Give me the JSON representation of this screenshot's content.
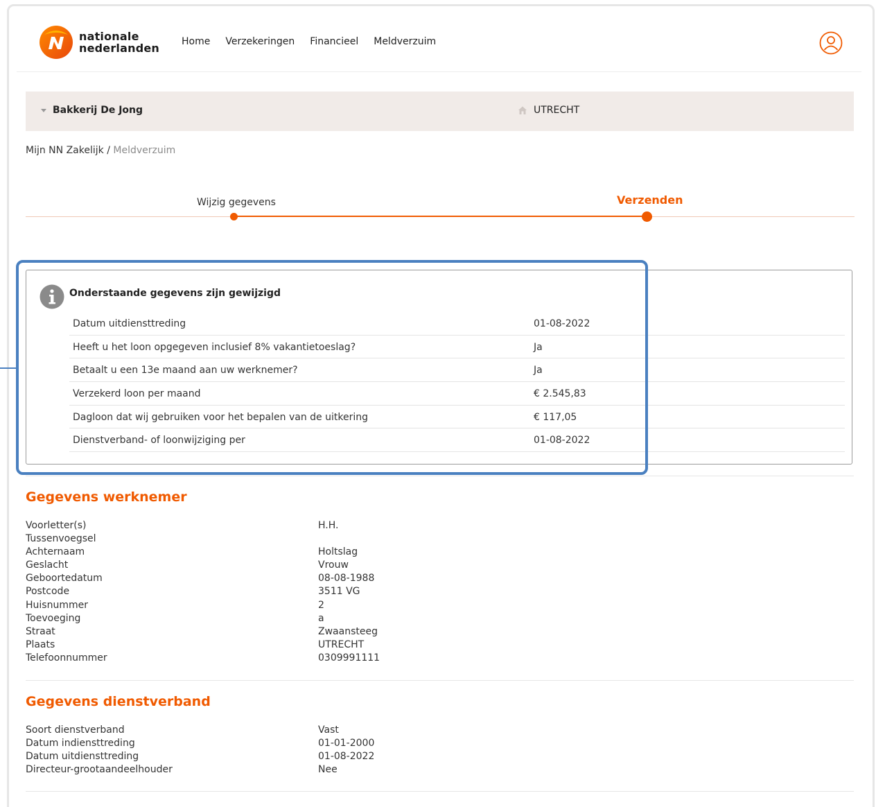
{
  "brand": {
    "line1": "nationale",
    "line2": "nederlanden",
    "orange": "#f05a00",
    "highlight": "#4a80c0"
  },
  "nav": {
    "items": [
      "Home",
      "Verzekeringen",
      "Financieel",
      "Meldverzuim"
    ]
  },
  "company_bar": {
    "company": "Bakkerij De Jong",
    "city": "UTRECHT"
  },
  "breadcrumb": {
    "root": "Mijn NN Zakelijk",
    "separator": " / ",
    "current": "Meldverzuim"
  },
  "stepper": {
    "step1": "Wijzig gegevens",
    "step2": "Verzenden"
  },
  "info_box": {
    "title": "Onderstaande gegevens zijn gewijzigd",
    "rows": [
      {
        "label": "Datum uitdiensttreding",
        "value": "01-08-2022"
      },
      {
        "label": "Heeft u het loon opgegeven inclusief 8% vakantietoeslag?",
        "value": "Ja"
      },
      {
        "label": "Betaalt u een 13e maand aan uw werknemer?",
        "value": "Ja"
      },
      {
        "label": "Verzekerd loon per maand",
        "value": "€ 2.545,83"
      },
      {
        "label": "Dagloon dat wij gebruiken voor het bepalen van de uitkering",
        "value": "€ 117,05"
      },
      {
        "label": "Dienstverband- of loonwijziging per",
        "value": "01-08-2022"
      }
    ]
  },
  "werknemer": {
    "title": "Gegevens werknemer",
    "rows": [
      {
        "label": "Voorletter(s)",
        "value": "H.H."
      },
      {
        "label": "Tussenvoegsel",
        "value": ""
      },
      {
        "label": "Achternaam",
        "value": "Holtslag"
      },
      {
        "label": "Geslacht",
        "value": "Vrouw"
      },
      {
        "label": "Geboortedatum",
        "value": "08-08-1988"
      },
      {
        "label": "Postcode",
        "value": "3511 VG"
      },
      {
        "label": "Huisnummer",
        "value": "2"
      },
      {
        "label": "Toevoeging",
        "value": "a"
      },
      {
        "label": "Straat",
        "value": "Zwaansteeg"
      },
      {
        "label": "Plaats",
        "value": "UTRECHT"
      },
      {
        "label": "Telefoonnummer",
        "value": "0309991111"
      }
    ]
  },
  "dienstverband": {
    "title": "Gegevens dienstverband",
    "rows": [
      {
        "label": "Soort dienstverband",
        "value": "Vast"
      },
      {
        "label": "Datum indiensttreding",
        "value": "01-01-2000"
      },
      {
        "label": "Datum uitdiensttreding",
        "value": "01-08-2022"
      },
      {
        "label": "Directeur-grootaandeelhouder",
        "value": "Nee"
      }
    ]
  }
}
